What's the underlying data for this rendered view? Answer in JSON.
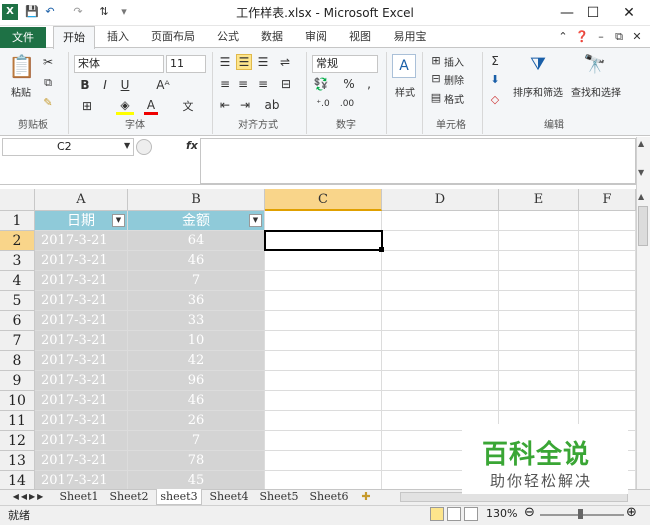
{
  "window": {
    "title": "工作样表.xlsx - Microsoft Excel"
  },
  "quick_access": {
    "save": "💾",
    "undo": "↶",
    "redo": "↷"
  },
  "tabs": [
    {
      "label": "文件"
    },
    {
      "label": "开始"
    },
    {
      "label": "插入"
    },
    {
      "label": "页面布局"
    },
    {
      "label": "公式"
    },
    {
      "label": "数据"
    },
    {
      "label": "审阅"
    },
    {
      "label": "视图"
    },
    {
      "label": "易用宝"
    }
  ],
  "ribbon": {
    "groups": {
      "clipboard": "剪贴板",
      "font": "字体",
      "alignment": "对齐方式",
      "number": "数字",
      "styles": "样式",
      "cells": "单元格",
      "editing": "编辑"
    },
    "paste": "粘贴",
    "font_name": "宋体",
    "font_size": "11",
    "number_format": "常规",
    "style_btn": "样式",
    "insert": "插入",
    "delete": "删除",
    "format": "格式",
    "sort_filter": "排序和筛选",
    "find_select": "查找和选择",
    "bold": "B",
    "italic": "I",
    "underline": "U",
    "percent": "%"
  },
  "formula_bar": {
    "name_box": "C2",
    "fx": "fx",
    "value": ""
  },
  "columns": [
    "A",
    "B",
    "C",
    "D",
    "E",
    "F"
  ],
  "rows": [
    "1",
    "2",
    "3",
    "4",
    "5",
    "6",
    "7",
    "8",
    "9",
    "10",
    "11",
    "12",
    "13",
    "14"
  ],
  "table": {
    "headers": [
      "日期",
      "金额"
    ],
    "dates": [
      "2017-3-21",
      "2017-3-21",
      "2017-3-21",
      "2017-3-21",
      "2017-3-21",
      "2017-3-21",
      "2017-3-21",
      "2017-3-21",
      "2017-3-21",
      "2017-3-21",
      "2017-3-21",
      "2017-3-21",
      "2017-3-21"
    ],
    "amounts": [
      "64",
      "46",
      "7",
      "36",
      "33",
      "10",
      "42",
      "96",
      "46",
      "26",
      "7",
      "78",
      "45"
    ]
  },
  "sheets": [
    "Sheet1",
    "Sheet2",
    "sheet3",
    "Sheet4",
    "Sheet5",
    "Sheet6"
  ],
  "status": {
    "ready": "就绪",
    "zoom": "130%"
  },
  "watermark": {
    "title": "百科全说",
    "subtitle": "助你轻松解决"
  }
}
